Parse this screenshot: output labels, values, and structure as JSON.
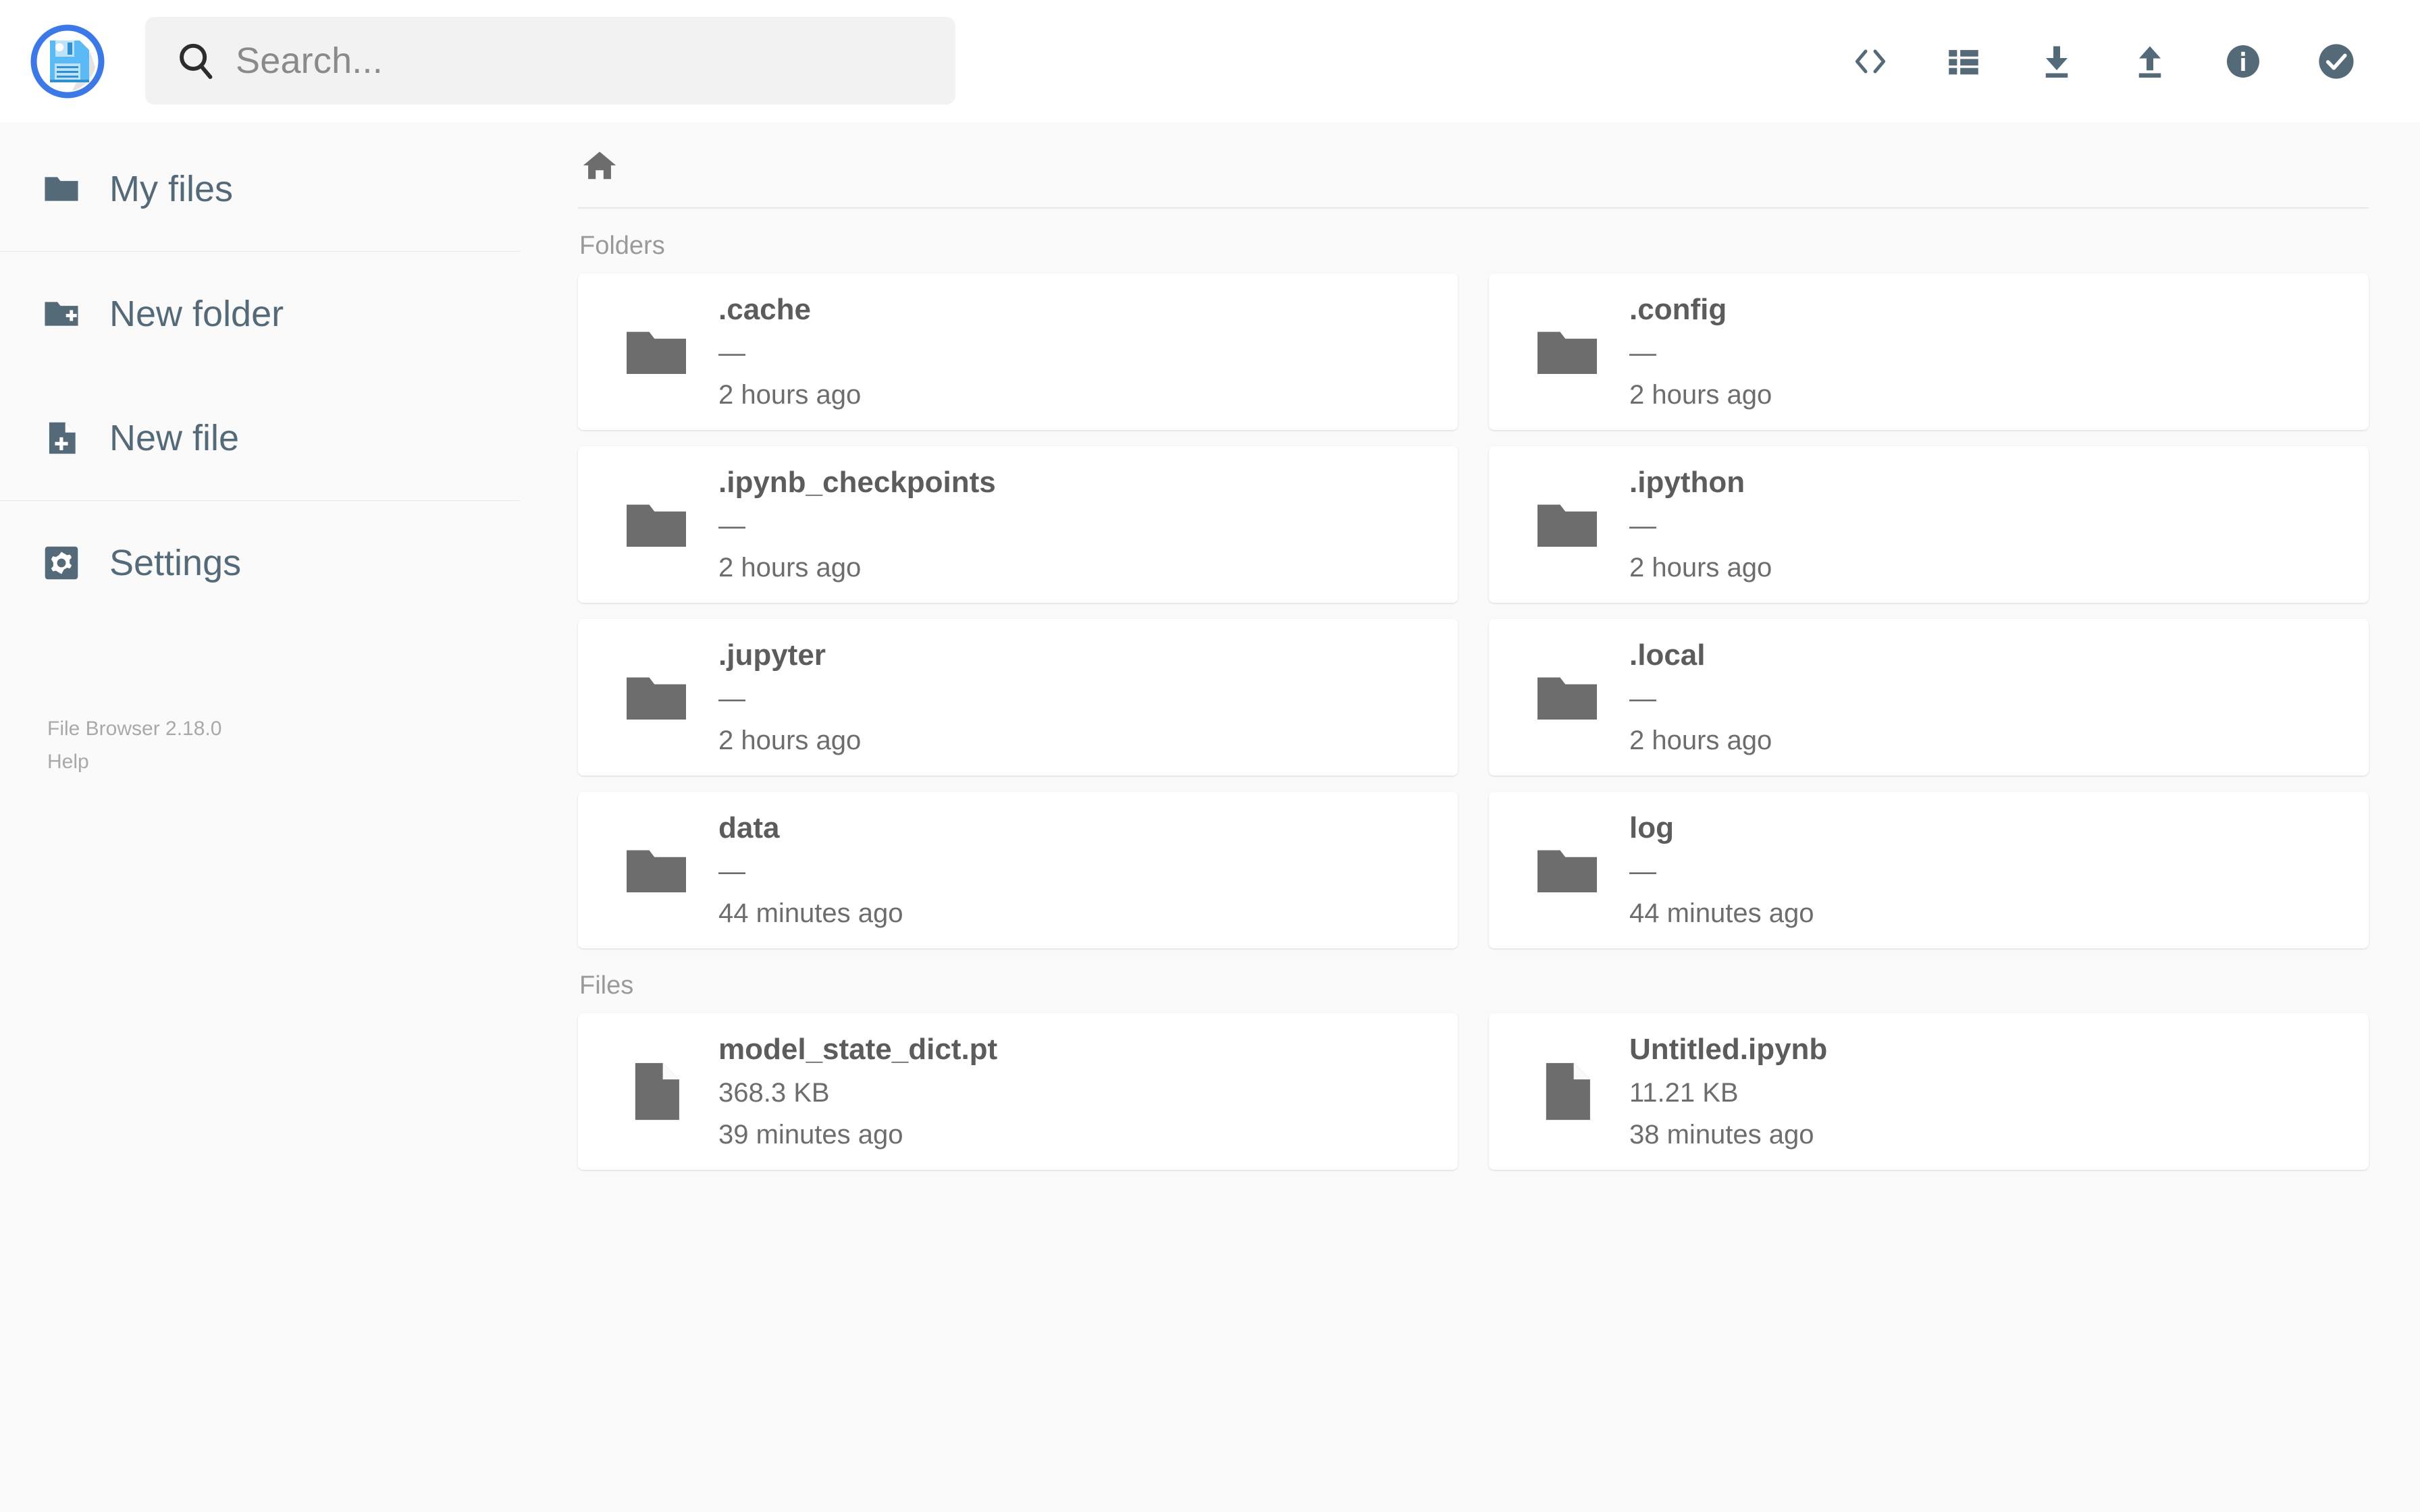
{
  "header": {
    "logo_icon": "floppy-disk-save-icon",
    "search": {
      "icon": "search-icon",
      "placeholder": "Search...",
      "value": ""
    },
    "actions": [
      {
        "icon": "code-brackets-icon",
        "label": "Shell"
      },
      {
        "icon": "list-view-icon",
        "label": "Switch view"
      },
      {
        "icon": "download-icon",
        "label": "Download"
      },
      {
        "icon": "upload-icon",
        "label": "Upload"
      },
      {
        "icon": "info-circle-icon",
        "label": "Info"
      },
      {
        "icon": "check-circle-icon",
        "label": "Select multiple"
      }
    ]
  },
  "sidebar": {
    "items": [
      {
        "icon": "folder-icon",
        "label": "My files"
      },
      {
        "icon": "folder-plus-icon",
        "label": "New folder"
      },
      {
        "icon": "file-plus-icon",
        "label": "New file"
      },
      {
        "icon": "gear-icon",
        "label": "Settings"
      }
    ],
    "version": "File Browser 2.18.0",
    "help": "Help"
  },
  "main": {
    "breadcrumb": {
      "home_icon": "home-icon"
    },
    "folders_title": "Folders",
    "files_title": "Files",
    "folders": [
      {
        "icon": "folder-icon",
        "name": ".cache",
        "size": "—",
        "time": "2 hours ago"
      },
      {
        "icon": "folder-icon",
        "name": ".config",
        "size": "—",
        "time": "2 hours ago"
      },
      {
        "icon": "folder-icon",
        "name": ".ipynb_checkpoints",
        "size": "—",
        "time": "2 hours ago"
      },
      {
        "icon": "folder-icon",
        "name": ".ipython",
        "size": "—",
        "time": "2 hours ago"
      },
      {
        "icon": "folder-icon",
        "name": ".jupyter",
        "size": "—",
        "time": "2 hours ago"
      },
      {
        "icon": "folder-icon",
        "name": ".local",
        "size": "—",
        "time": "2 hours ago"
      },
      {
        "icon": "folder-icon",
        "name": "data",
        "size": "—",
        "time": "44 minutes ago"
      },
      {
        "icon": "folder-icon",
        "name": "log",
        "size": "—",
        "time": "44 minutes ago"
      }
    ],
    "files": [
      {
        "icon": "file-icon",
        "name": "model_state_dict.pt",
        "size": "368.3 KB",
        "time": "39 minutes ago"
      },
      {
        "icon": "file-icon",
        "name": "Untitled.ipynb",
        "size": "11.21 KB",
        "time": "38 minutes ago"
      }
    ]
  },
  "colors": {
    "accent_blue": "#3c78e6",
    "logo_disk": "#5bb9f5",
    "icon_gray": "#546a79",
    "item_gray": "#6d6d6d",
    "page_bg": "#fafafa",
    "card_bg": "#ffffff",
    "header_bg": "#ffffff",
    "search_bg": "#f2f2f2"
  }
}
